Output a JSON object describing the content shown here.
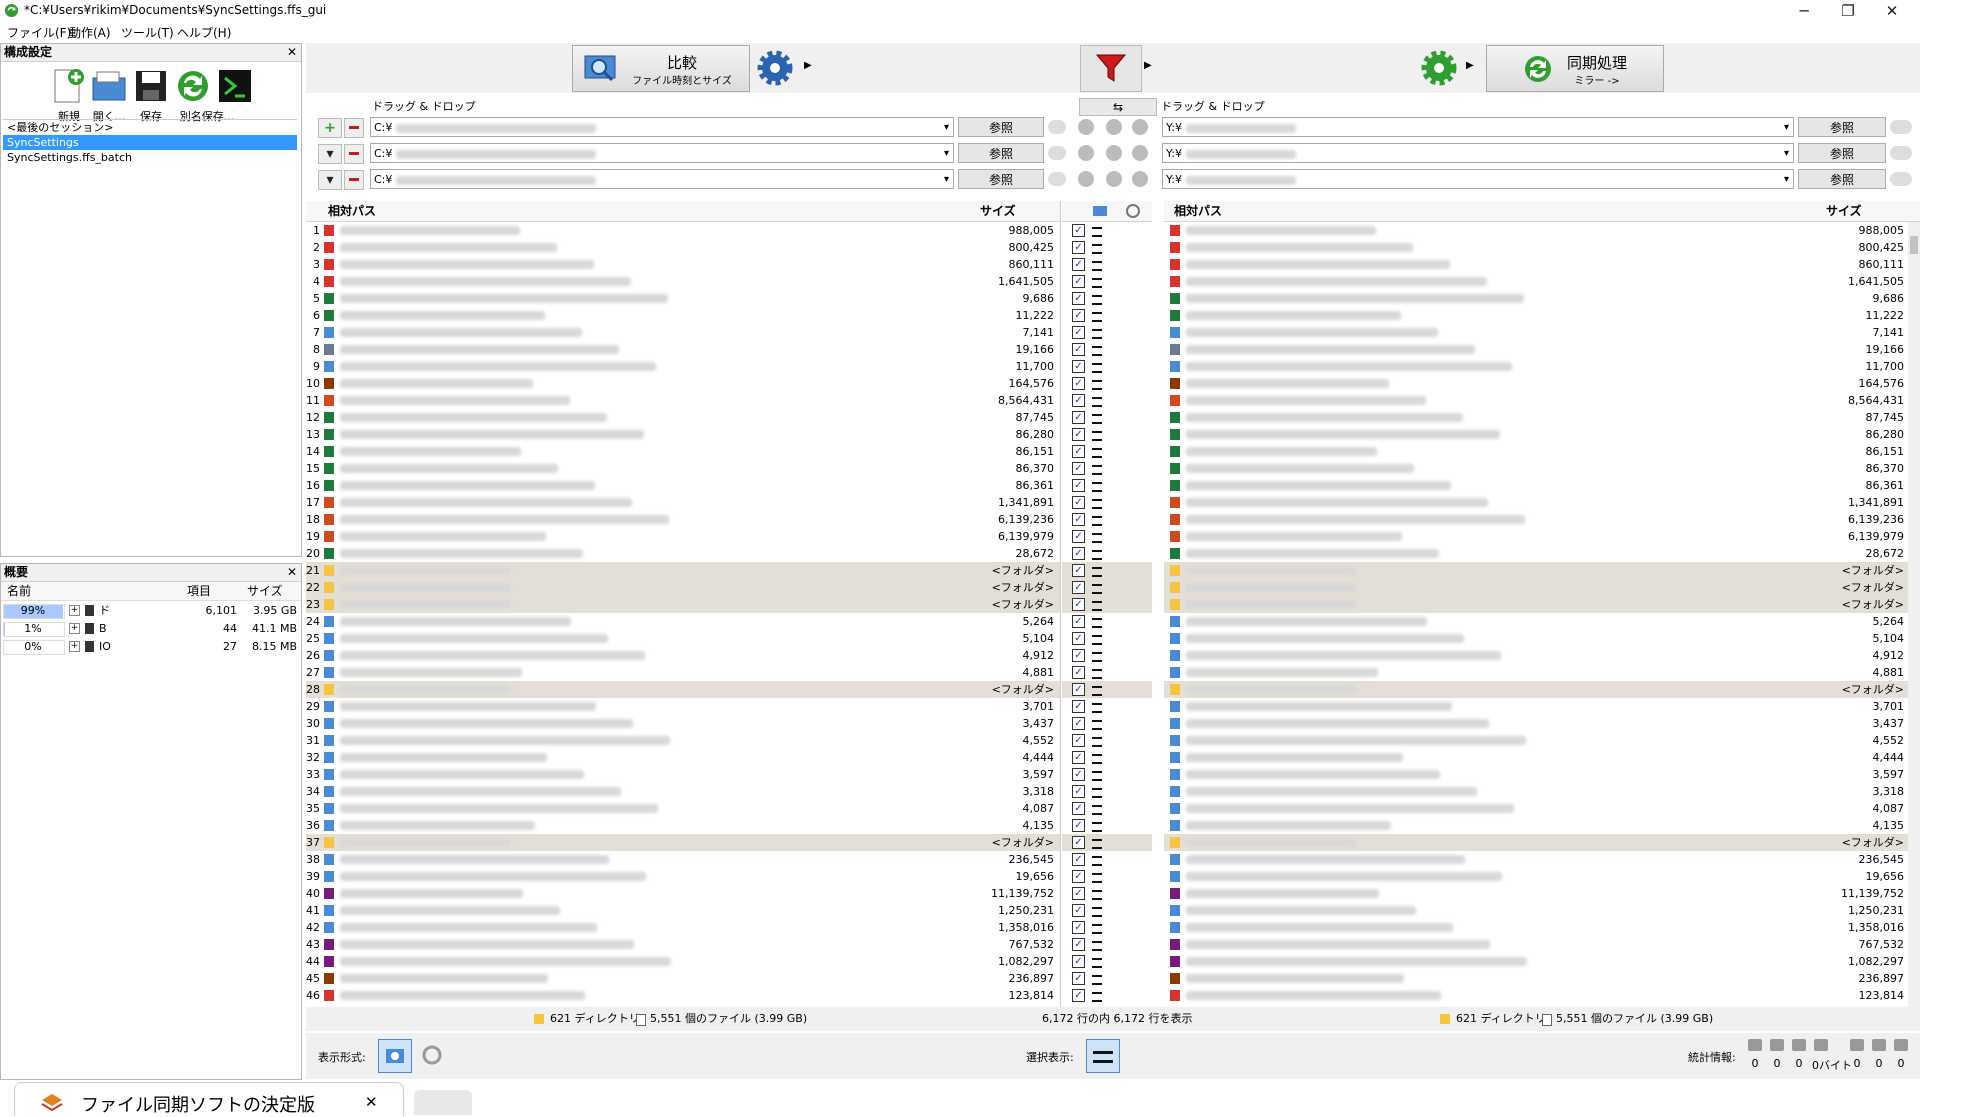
{
  "window": {
    "title": "*C:¥Users¥rikim¥Documents¥SyncSettings.ffs_gui",
    "minimize": "─",
    "maximize": "❐",
    "close": "✕"
  },
  "menu": [
    "ファイル(F)",
    "動作(A)",
    "ツール(T)",
    "ヘルプ(H)"
  ],
  "config_panel": {
    "title": "構成設定",
    "buttons": [
      "新規",
      "開く...",
      "保存",
      "別名保存..."
    ],
    "items": [
      "<最後のセッション>",
      "SyncSettings",
      "SyncSettings.ffs_batch"
    ],
    "selected_item": "SyncSettings"
  },
  "overview_panel": {
    "title": "概要",
    "headers": [
      "名前",
      "項目",
      "サイズ"
    ],
    "rows": [
      {
        "pct": "99%",
        "name": "ド",
        "items": "6,101",
        "size": "3.95 GB",
        "pct_value": 99
      },
      {
        "pct": "1%",
        "name": "B",
        "items": "44",
        "size": "41.1 MB",
        "pct_value": 1
      },
      {
        "pct": "0%",
        "name": "IO",
        "items": "27",
        "size": "8.15 MB",
        "pct_value": 0
      }
    ]
  },
  "toolbar": {
    "compare_label": "比較",
    "compare_sub": "ファイル時刻とサイズ",
    "sync_label": "同期処理",
    "sync_sub": "ミラー ->"
  },
  "folders": {
    "left_label": "ドラッグ & ドロップ",
    "right_label": "ドラッグ & ドロップ",
    "swap_icon": "⇆",
    "browse": "参照",
    "left_paths": [
      "C:¥",
      "C:¥",
      "C:¥"
    ],
    "right_paths": [
      "Y:¥",
      "Y:¥",
      "Y:¥"
    ]
  },
  "grid": {
    "col_path": "相対パス",
    "col_size": "サイズ",
    "folder_label": "<フォルダ>",
    "rows": [
      {
        "n": "1",
        "t": "pdf",
        "s": "988,005"
      },
      {
        "n": "2",
        "t": "pdf",
        "s": "800,425"
      },
      {
        "n": "3",
        "t": "pdf",
        "s": "860,111"
      },
      {
        "n": "4",
        "t": "pdf",
        "s": "1,641,505"
      },
      {
        "n": "5",
        "t": "xls",
        "s": "9,686"
      },
      {
        "n": "6",
        "t": "xls",
        "s": "11,222"
      },
      {
        "n": "7",
        "t": "img",
        "s": "7,141"
      },
      {
        "n": "8",
        "t": "doc",
        "s": "19,166"
      },
      {
        "n": "9",
        "t": "img",
        "s": "11,700"
      },
      {
        "n": "10",
        "t": "ai",
        "s": "164,576"
      },
      {
        "n": "11",
        "t": "ppt",
        "s": "8,564,431"
      },
      {
        "n": "12",
        "t": "xls",
        "s": "87,745"
      },
      {
        "n": "13",
        "t": "xls",
        "s": "86,280"
      },
      {
        "n": "14",
        "t": "xls",
        "s": "86,151"
      },
      {
        "n": "15",
        "t": "xls",
        "s": "86,370"
      },
      {
        "n": "16",
        "t": "xls",
        "s": "86,361"
      },
      {
        "n": "17",
        "t": "ppt",
        "s": "1,341,891"
      },
      {
        "n": "18",
        "t": "ppt",
        "s": "6,139,236"
      },
      {
        "n": "19",
        "t": "ppt",
        "s": "6,139,979"
      },
      {
        "n": "20",
        "t": "xls",
        "s": "28,672"
      },
      {
        "n": "21",
        "t": "folder",
        "s": "<フォルダ>"
      },
      {
        "n": "22",
        "t": "folder",
        "s": "<フォルダ>"
      },
      {
        "n": "23",
        "t": "folder",
        "s": "<フォルダ>"
      },
      {
        "n": "24",
        "t": "img",
        "s": "5,264"
      },
      {
        "n": "25",
        "t": "img",
        "s": "5,104"
      },
      {
        "n": "26",
        "t": "img",
        "s": "4,912"
      },
      {
        "n": "27",
        "t": "img",
        "s": "4,881"
      },
      {
        "n": "28",
        "t": "folder",
        "s": "<フォルダ>"
      },
      {
        "n": "29",
        "t": "img",
        "s": "3,701"
      },
      {
        "n": "30",
        "t": "img",
        "s": "3,437"
      },
      {
        "n": "31",
        "t": "img",
        "s": "4,552"
      },
      {
        "n": "32",
        "t": "img",
        "s": "4,444"
      },
      {
        "n": "33",
        "t": "img",
        "s": "3,597"
      },
      {
        "n": "34",
        "t": "img",
        "s": "3,318"
      },
      {
        "n": "35",
        "t": "img",
        "s": "4,087"
      },
      {
        "n": "36",
        "t": "img",
        "s": "4,135"
      },
      {
        "n": "37",
        "t": "folder",
        "s": "<フォルダ>"
      },
      {
        "n": "38",
        "t": "img",
        "s": "236,545"
      },
      {
        "n": "39",
        "t": "img",
        "s": "19,656"
      },
      {
        "n": "40",
        "t": "psd",
        "s": "11,139,752"
      },
      {
        "n": "41",
        "t": "img",
        "s": "1,250,231"
      },
      {
        "n": "42",
        "t": "img",
        "s": "1,358,016"
      },
      {
        "n": "43",
        "t": "psd",
        "s": "767,532"
      },
      {
        "n": "44",
        "t": "psd",
        "s": "1,082,297"
      },
      {
        "n": "45",
        "t": "ai",
        "s": "236,897"
      },
      {
        "n": "46",
        "t": "pdf",
        "s": "123,814"
      }
    ]
  },
  "status": {
    "left_dirs": "621 ディレクトリ",
    "left_files": "5,551 個のファイル (3.99 GB)",
    "center": "6,172 行の内 6,172 行を表示",
    "right_dirs": "621 ディレクトリ",
    "right_files": "5,551 個のファイル (3.99 GB)"
  },
  "bottom": {
    "view_label": "表示形式:",
    "select_label": "選択表示:",
    "stats_label": "統計情報:",
    "stats": [
      "0",
      "0",
      "0",
      "0バイト",
      "0",
      "0",
      "0"
    ]
  },
  "taskbar": {
    "tab_label": "ファイル同期ソフトの決定版",
    "tab_close": "✕"
  },
  "colors": {
    "accent": "#3399ff",
    "folder_row": "#e4dfd6",
    "green": "#2e9e2e",
    "red": "#cc1b1b"
  }
}
